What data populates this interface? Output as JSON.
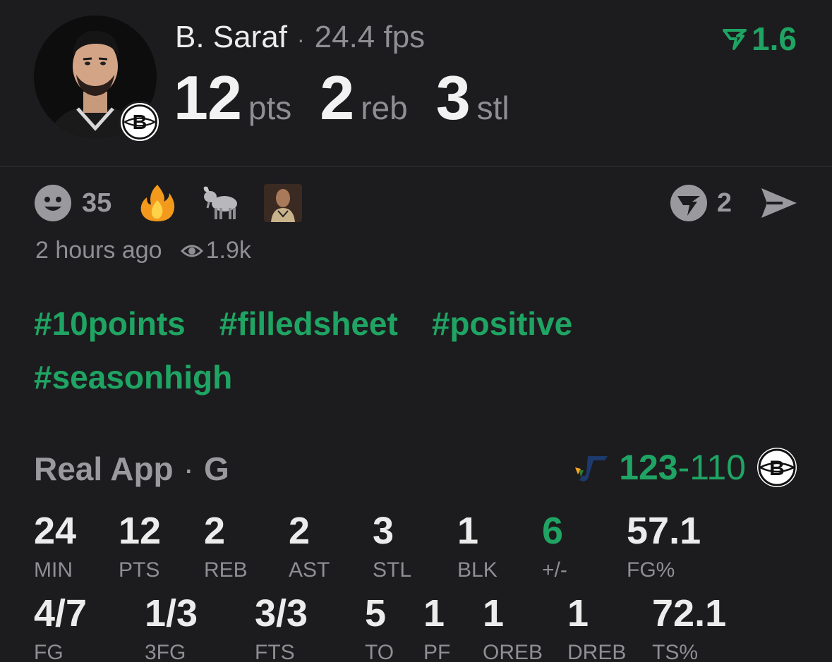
{
  "header": {
    "player_name": "B. Saraf",
    "separator": "·",
    "fps": "24.4 fps",
    "rating": "1.6",
    "stats": [
      {
        "value": "12",
        "unit": "pts"
      },
      {
        "value": "2",
        "unit": "reb"
      },
      {
        "value": "3",
        "unit": "stl"
      }
    ]
  },
  "reactions": {
    "count": "35",
    "emojis": [
      "fire-icon",
      "goat-icon",
      "reaction-gif"
    ],
    "comment_count": "2"
  },
  "meta": {
    "time_ago": "2 hours ago",
    "views": "1.9k"
  },
  "hashtags": [
    "#10points",
    "#filledsheet",
    "#positive",
    "#seasonhigh"
  ],
  "game": {
    "source": "Real App",
    "separator": "·",
    "position": "G",
    "score_winner": "123",
    "score_sep": "-",
    "score_loser": "110"
  },
  "box_score": {
    "row1": [
      {
        "value": "24",
        "label": "MIN"
      },
      {
        "value": "12",
        "label": "PTS"
      },
      {
        "value": "2",
        "label": "REB"
      },
      {
        "value": "2",
        "label": "AST"
      },
      {
        "value": "3",
        "label": "STL"
      },
      {
        "value": "1",
        "label": "BLK"
      },
      {
        "value": "6",
        "label": "+/-"
      },
      {
        "value": "57.1",
        "label": "FG%"
      }
    ],
    "row2": [
      {
        "value": "4/7",
        "label": "FG"
      },
      {
        "value": "1/3",
        "label": "3FG"
      },
      {
        "value": "3/3",
        "label": "FTS"
      },
      {
        "value": "5",
        "label": "TO"
      },
      {
        "value": "1",
        "label": "PF"
      },
      {
        "value": "1",
        "label": "OREB"
      },
      {
        "value": "1",
        "label": "DREB"
      },
      {
        "value": "72.1",
        "label": "TS%"
      }
    ]
  },
  "colors": {
    "background": "#1c1c1e",
    "accent_green": "#1fa463",
    "muted_text": "#8e8e93",
    "primary_text": "#ececec"
  }
}
